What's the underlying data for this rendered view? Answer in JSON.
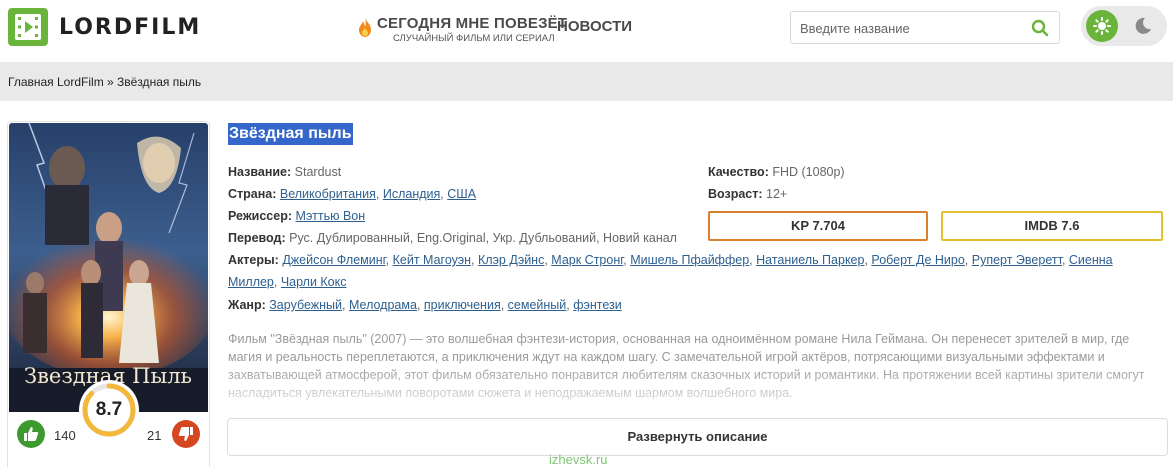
{
  "header": {
    "logo_text": "LORDFILM",
    "lucky_title": "СЕГОДНЯ МНЕ ПОВЕЗЁТ",
    "lucky_subtitle": "СЛУЧАЙНЫЙ ФИЛЬМ ИЛИ СЕРИАЛ",
    "news_label": "НОВОСТИ",
    "search_placeholder": "Введите название",
    "theme_active": "light"
  },
  "breadcrumb": "Главная LordFilm » Звёздная пыль",
  "poster": {
    "poster_title": "Звездная Пыль",
    "rating": "8.7",
    "likes": "140",
    "dislikes": "21"
  },
  "movie": {
    "title": "Звёздная пыль",
    "fields": {
      "name_label": "Название:",
      "name_value": "Stardust",
      "country_label": "Страна:",
      "countries": [
        "Великобритания",
        "Исландия",
        "США"
      ],
      "director_label": "Режиссер:",
      "director": "Мэттью Вон",
      "translation_label": "Перевод:",
      "translation": "Рус. Дублированный, Eng.Original, Укр. Дубльований, Новий канал",
      "actors_label": "Актеры:",
      "actors": [
        "Джейсон Флеминг",
        "Кейт Магоуэн",
        "Клэр Дэйнс",
        "Марк Стронг",
        "Мишель Пфайффер",
        "Натаниель Паркер",
        "Роберт Де Ниро",
        "Руперт Эверетт",
        "Сиенна Миллер",
        "Чарли Кокс"
      ],
      "genre_label": "Жанр:",
      "genres": [
        "Зарубежный",
        "Мелодрама",
        "приключения",
        "семейный",
        "фэнтези"
      ],
      "quality_label": "Качество:",
      "quality": "FHD (1080p)",
      "age_label": "Возраст:",
      "age": "12+"
    },
    "kp_rating": "KP 7.704",
    "imdb_rating": "IMDB 7.6",
    "description": "Фильм \"Звёздная пыль\" (2007) — это волшебная фэнтези-история, основанная на одноимённом романе Нила Геймана. Он перенесет зрителей в мир, где магия и реальность переплетаются, а приключения ждут на каждом шагу. С замечательной игрой актёров, потрясающими визуальными эффектами и захватывающей атмосферой, этот фильм обязательно понравится любителям сказочных историй и романтики. На протяжении всей картины зрители смогут насладиться увлекательными поворотами сюжета и неподражаемым шармом волшебного мира.",
    "expand_label": "Развернуть описание"
  },
  "watermark": "izhevsk.ru",
  "colors": {
    "brand_green": "#6bb43c",
    "title_highlight": "#3467c9",
    "link": "#2d5f8f",
    "kp_border": "#d9802f",
    "imdb_border": "#e2c12f",
    "like": "#3c9a2e",
    "dislike": "#d6461f"
  }
}
